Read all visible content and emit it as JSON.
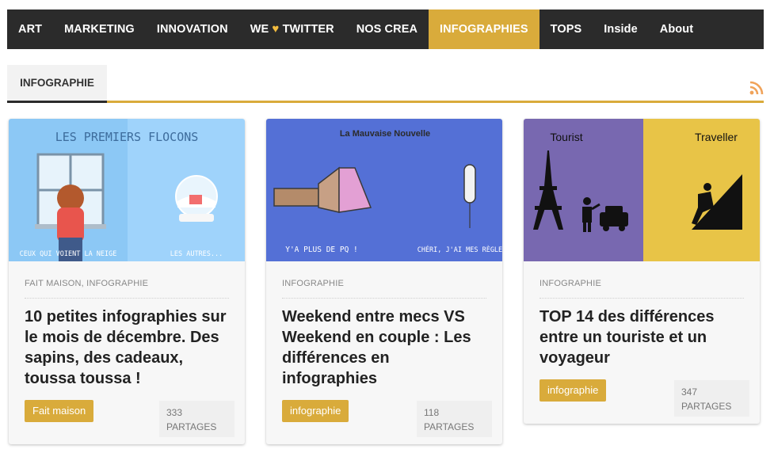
{
  "nav": {
    "items": [
      {
        "label": "ART"
      },
      {
        "label": "MARKETING"
      },
      {
        "label": "INNOVATION"
      },
      {
        "label_before": "WE",
        "label_after": "TWITTER"
      },
      {
        "label": "NOS CREA"
      },
      {
        "label": "INFOGRAPHIES",
        "active": true
      },
      {
        "label": "TOPS"
      },
      {
        "label": "Inside"
      },
      {
        "label": "About"
      }
    ]
  },
  "tabs": {
    "active_label": "INFOGRAPHIE",
    "rss_icon": "rss-icon"
  },
  "colors": {
    "nav_bg": "#2b2b2b",
    "accent": "#d9ab3b",
    "card_bg": "#f7f7f7"
  },
  "cards": [
    {
      "image_texts": {
        "top": "LES PREMIERS FLOCONS",
        "left": "CEUX QUI VOIENT LA NEIGE",
        "right": "LES AUTRES..."
      },
      "categories": "FAIT MAISON, INFOGRAPHIE",
      "title": "10 petites infographies sur le mois de décembre. Des sapins, des cadeaux, toussa toussa !",
      "tag": "Fait maison",
      "shares_count": "333",
      "shares_label": "PARTAGES"
    },
    {
      "image_texts": {
        "top": "La Mauvaise Nouvelle",
        "left": "Y'A PLUS DE PQ !",
        "right": "CHÉRI, J'AI MES RÈGLES"
      },
      "categories": "INFOGRAPHIE",
      "title": "Weekend entre mecs VS Weekend en couple : Les différences en infographies",
      "tag": "infographie",
      "shares_count": "118",
      "shares_label": "PARTAGES"
    },
    {
      "image_texts": {
        "left": "Tourist",
        "right": "Traveller"
      },
      "categories": "INFOGRAPHIE",
      "title": "TOP 14 des différences entre un touriste et un voyageur",
      "tag": "infographie",
      "shares_count": "347",
      "shares_label": "PARTAGES"
    }
  ]
}
